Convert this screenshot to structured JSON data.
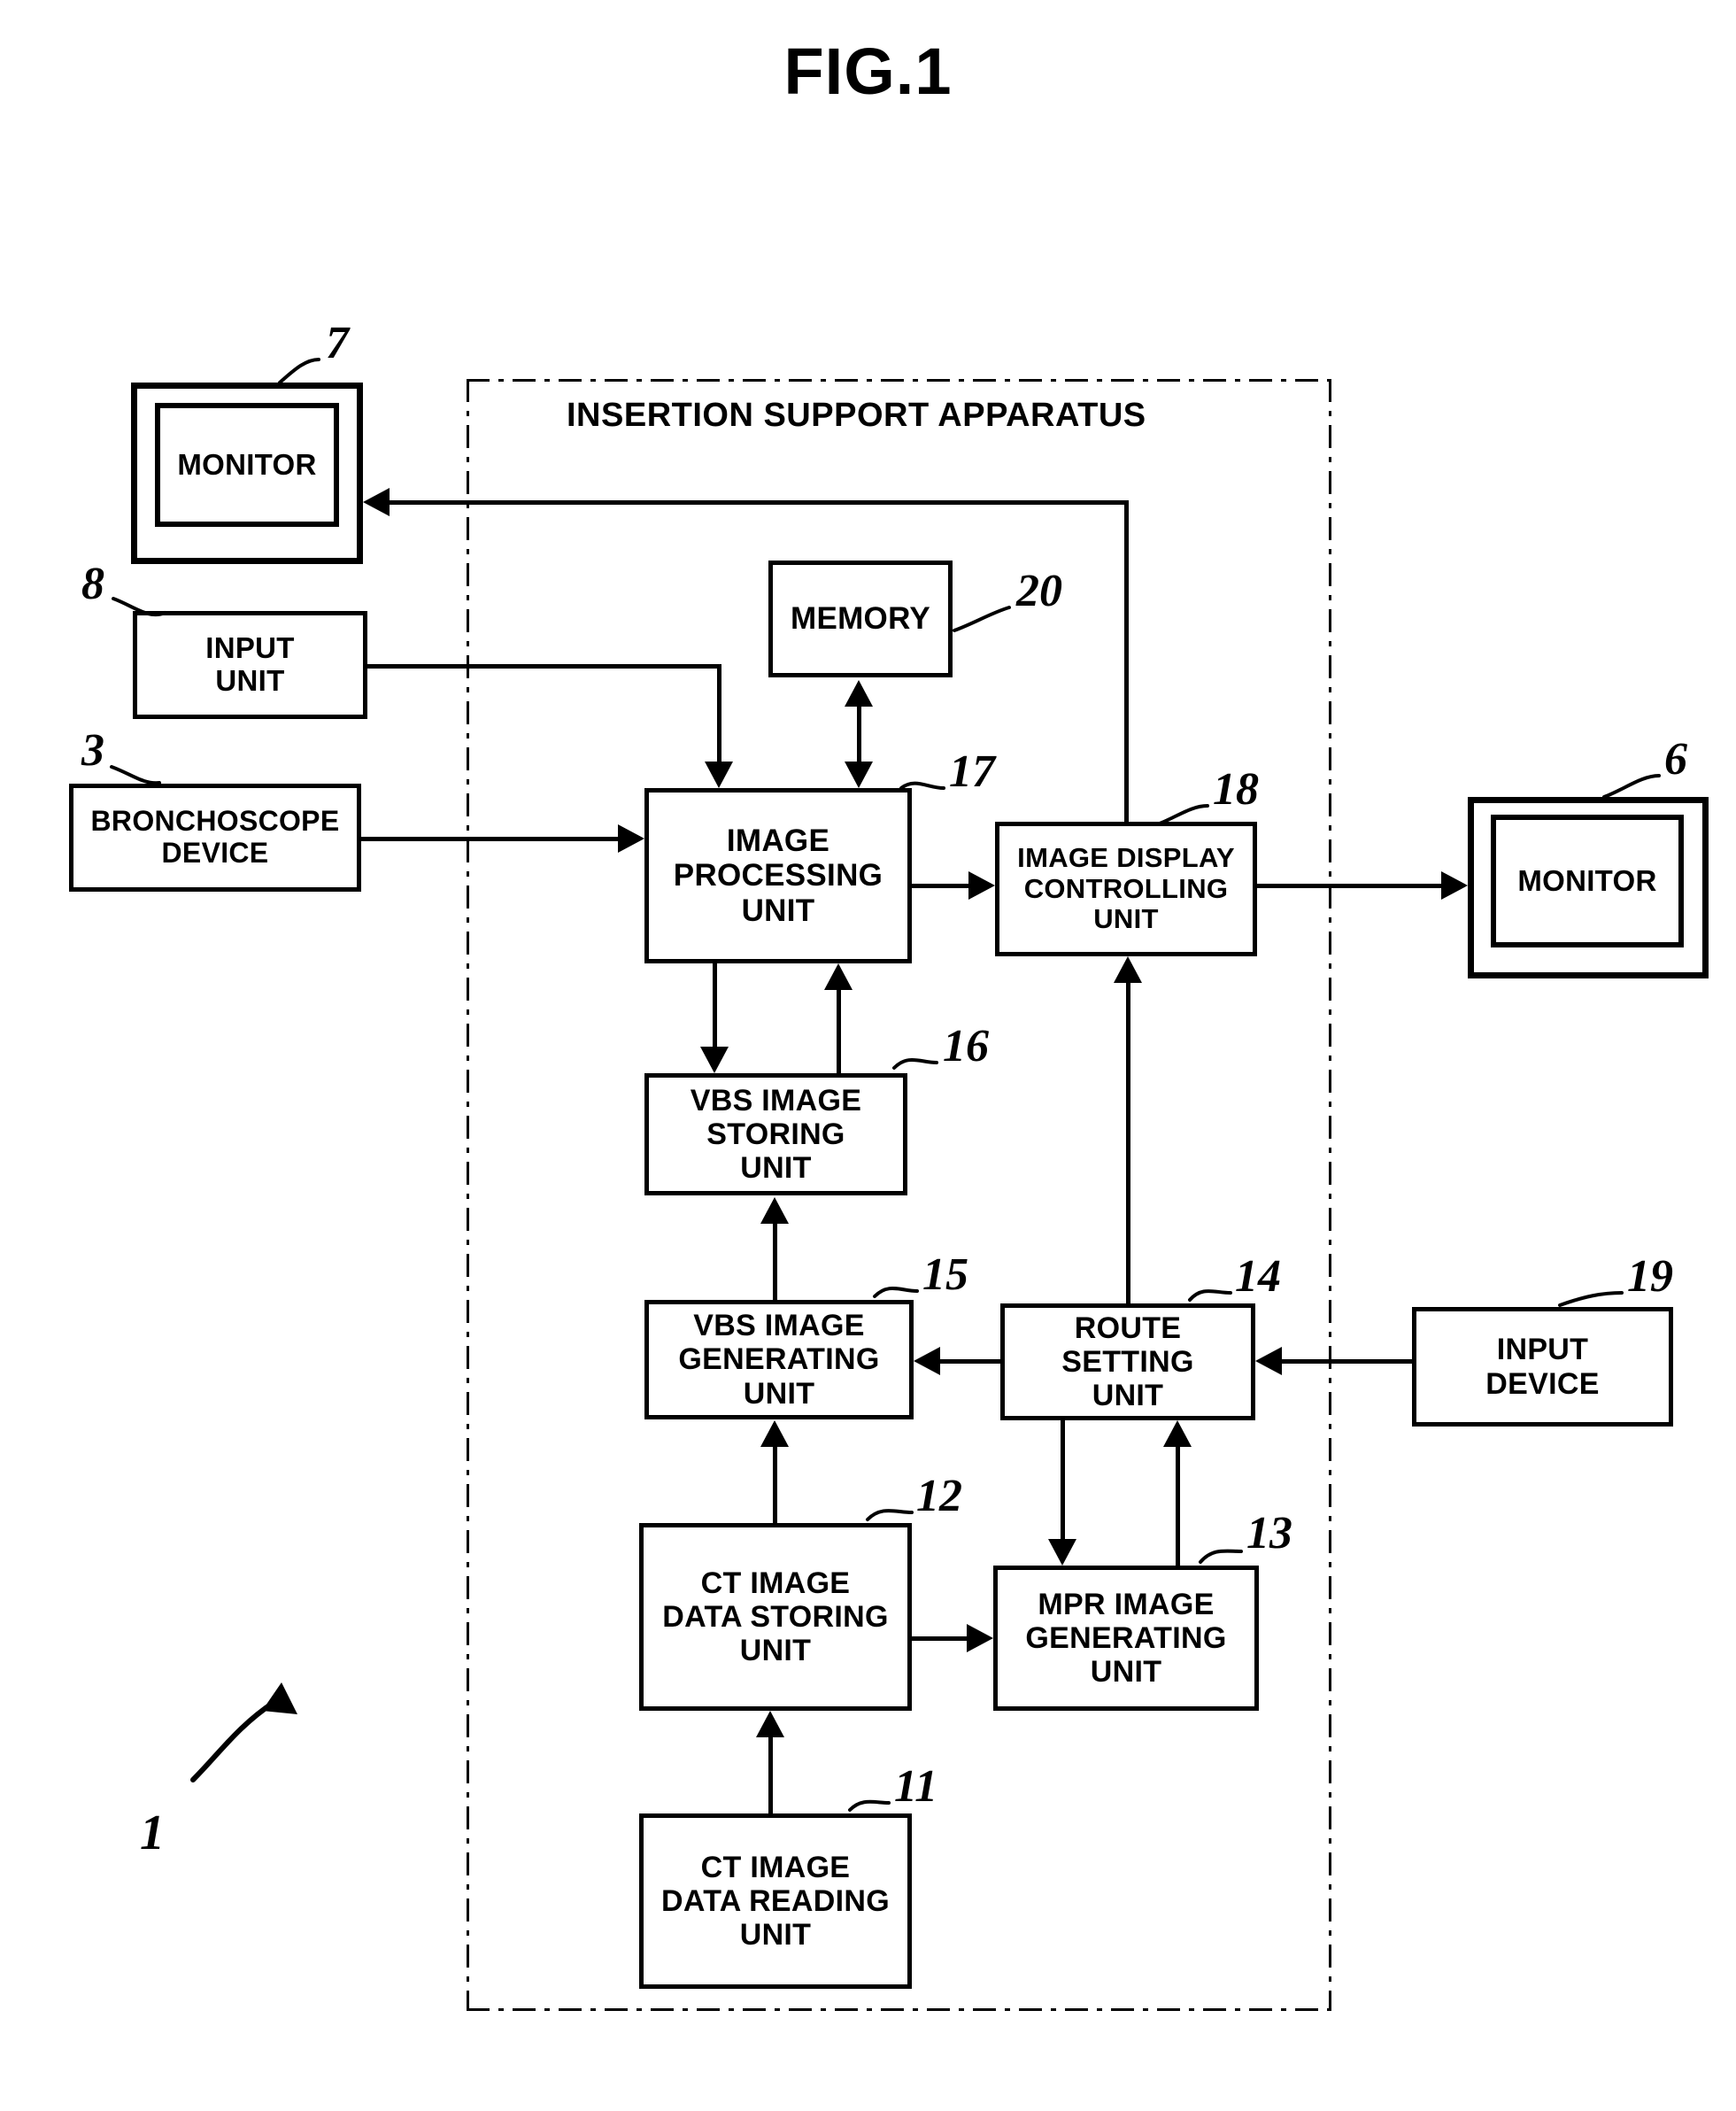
{
  "figure": {
    "title": "FIG.1",
    "apparatus_label": "INSERTION SUPPORT APPARATUS",
    "system_ref": "1"
  },
  "blocks": [
    {
      "id": "monitor7",
      "label": "MONITOR",
      "ref": "7"
    },
    {
      "id": "input_unit8",
      "label": "INPUT\nUNIT",
      "ref": "8"
    },
    {
      "id": "bronchoscope3",
      "label": "BRONCHOSCOPE\nDEVICE",
      "ref": "3"
    },
    {
      "id": "memory20",
      "label": "MEMORY",
      "ref": "20"
    },
    {
      "id": "imgproc17",
      "label": "IMAGE\nPROCESSING\nUNIT",
      "ref": "17"
    },
    {
      "id": "imgdisp18",
      "label": "IMAGE DISPLAY\nCONTROLLING\nUNIT",
      "ref": "18"
    },
    {
      "id": "monitor6",
      "label": "MONITOR",
      "ref": "6"
    },
    {
      "id": "vbsstore16",
      "label": "VBS IMAGE\nSTORING\nUNIT",
      "ref": "16"
    },
    {
      "id": "vbsgen15",
      "label": "VBS IMAGE\nGENERATING\nUNIT",
      "ref": "15"
    },
    {
      "id": "route14",
      "label": "ROUTE\nSETTING\nUNIT",
      "ref": "14"
    },
    {
      "id": "inputdev19",
      "label": "INPUT\nDEVICE",
      "ref": "19"
    },
    {
      "id": "ctstore12",
      "label": "CT IMAGE\nDATA STORING\nUNIT",
      "ref": "12"
    },
    {
      "id": "mprgen13",
      "label": "MPR IMAGE\nGENERATING\nUNIT",
      "ref": "13"
    },
    {
      "id": "ctread11",
      "label": "CT IMAGE\nDATA READING\nUNIT",
      "ref": "11"
    }
  ],
  "connections": [
    {
      "from": "imgdisp18",
      "to": "monitor7",
      "direction": "left"
    },
    {
      "from": "input_unit8",
      "to": "imgproc17",
      "direction": "down"
    },
    {
      "from": "bronchoscope3",
      "to": "imgproc17",
      "direction": "right"
    },
    {
      "from": "memory20",
      "to": "imgproc17",
      "direction": "both"
    },
    {
      "from": "imgproc17",
      "to": "imgdisp18",
      "direction": "right"
    },
    {
      "from": "imgdisp18",
      "to": "monitor6",
      "direction": "right"
    },
    {
      "from": "imgproc17",
      "to": "vbsstore16",
      "direction": "down"
    },
    {
      "from": "vbsstore16",
      "to": "imgproc17",
      "direction": "up"
    },
    {
      "from": "vbsgen15",
      "to": "vbsstore16",
      "direction": "up"
    },
    {
      "from": "route14",
      "to": "vbsgen15",
      "direction": "left"
    },
    {
      "from": "inputdev19",
      "to": "route14",
      "direction": "left"
    },
    {
      "from": "route14",
      "to": "imgdisp18",
      "direction": "up"
    },
    {
      "from": "ctstore12",
      "to": "vbsgen15",
      "direction": "up"
    },
    {
      "from": "ctstore12",
      "to": "mprgen13",
      "direction": "right"
    },
    {
      "from": "route14",
      "to": "mprgen13",
      "direction": "down"
    },
    {
      "from": "mprgen13",
      "to": "route14",
      "direction": "up"
    },
    {
      "from": "ctread11",
      "to": "ctstore12",
      "direction": "up"
    }
  ],
  "colors": {
    "ink": "#000000",
    "paper": "#ffffff"
  }
}
